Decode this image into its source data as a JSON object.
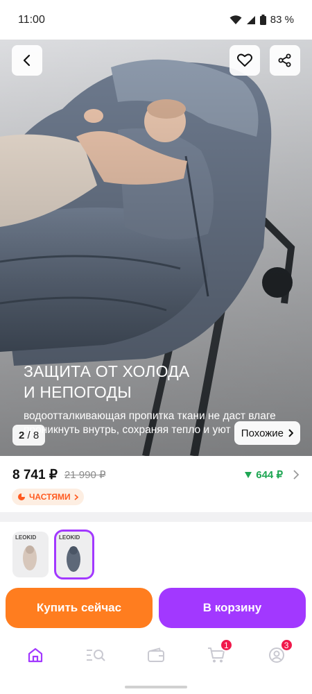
{
  "status_bar": {
    "time": "11:00",
    "battery": "83 %"
  },
  "gallery": {
    "title_line1": "ЗАЩИТА ОТ ХОЛОДА",
    "title_line2": "И НЕПОГОДЫ",
    "text": "водоотталкивающая пропитка ткани не даст влаге проникнуть внутрь, сохраняя тепло и уют",
    "current": "2",
    "total": "8",
    "similar_label": "Похожие"
  },
  "price": {
    "current": "8 741 ₽",
    "old": "21 990 ₽",
    "cashback": "644 ₽"
  },
  "installments_label": "ЧАСТЯМИ",
  "variants": [
    {
      "brand": "LEOKID",
      "selected": false
    },
    {
      "brand": "LEOKID",
      "selected": true
    }
  ],
  "actions": {
    "buy_now": "Купить сейчас",
    "add_to_cart": "В корзину"
  },
  "tabbar": {
    "cart_badge": "1",
    "profile_badge": "3"
  },
  "colors": {
    "accent": "#a238ff",
    "orange": "#ff7d1f",
    "green": "#1ea653",
    "badge": "#f0194b"
  }
}
